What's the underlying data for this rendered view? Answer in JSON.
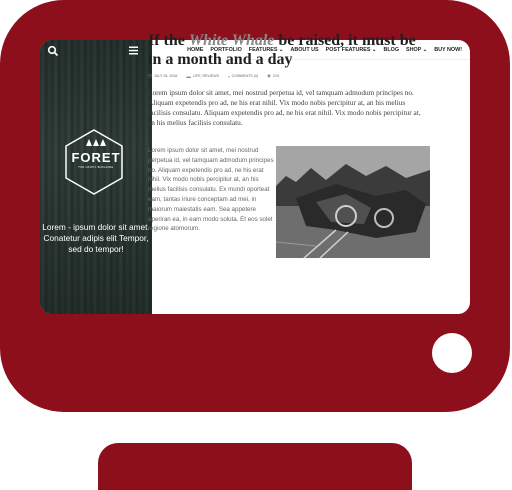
{
  "nav": {
    "items": [
      "HOME",
      "PORTFOLIO",
      "FEATURES ⌄",
      "ABOUT US",
      "POST FEATURES ⌄",
      "BLOG",
      "SHOP ⌄",
      "BUY NOW!"
    ]
  },
  "sidebar": {
    "logo_title": "FORET",
    "logo_subtitle": "FOR LOVELY BLOGGING",
    "tagline": "Lorem - ipsum dolor sit amet. Conatetur adipis elit Tempor, sed do tempor!"
  },
  "article": {
    "title_before": "If the ",
    "title_emph": "White Whale",
    "title_after": " be raised, it must be in a month and a day",
    "meta_date": "JULY 26, 2016",
    "meta_categories": "LIFE, REVIEWS",
    "meta_comments": "COMMENTS (0)",
    "meta_views": "219",
    "lead": "Lorem ipsum dolor sit amet, mei nostrud perpetua id, vel tamquam admodum principes no. Aliquam expetendis pro ad, ne his erat nihil. Vix modo nobis percipitur at, an his melius facilisis consulatu. Aliquam expetendis pro ad, ne his erat nihil. Vix modo nobis percipitur at, an his melius facilisis consulatu.",
    "body": "Lorem ipsum dolor sit amet, mei nostrud perpetua id, vel tamquam admodum principes no. Aliquam expetendis pro ad, ne his erat nihil. Vix modo nobis percipitur at, an his melius facilisis consulatu. Ex mundi oporteat eam, tantas iriure conceptam ad mei, in maiorum maiestatis eam. Sea appetere aperiran ea, in eam modo soluta. Et eos solet regione atomorum."
  },
  "colors": {
    "monitor": "#8d0f1c",
    "screen": "#ffffff"
  }
}
